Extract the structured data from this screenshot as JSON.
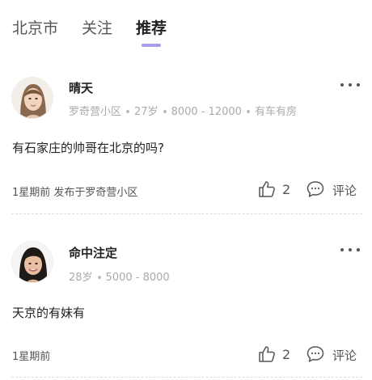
{
  "tabs": [
    {
      "label": "北京市"
    },
    {
      "label": "关注"
    },
    {
      "label": "推荐"
    }
  ],
  "colors": {
    "accent": "#a99bf0",
    "meta_text": "#aaaaaa",
    "primary_text": "#222222"
  },
  "posts": [
    {
      "name": "晴天",
      "meta": [
        "罗奇营小区",
        "27岁",
        "8000 - 12000",
        "有车有房"
      ],
      "content": "有石家庄的帅哥在北京的吗?",
      "time": "1星期前",
      "location": "发布于罗奇营小区",
      "likes": "2",
      "comment_label": "评论",
      "avatar_icon": "female-avatar",
      "more_icon": "more-dots-icon"
    },
    {
      "name": "命中注定",
      "meta": [
        "28岁",
        "5000 - 8000"
      ],
      "content": "天京的有妹有",
      "time": "1星期前",
      "location": "",
      "likes": "2",
      "comment_label": "评论",
      "avatar_icon": "female-avatar",
      "more_icon": "more-dots-icon"
    }
  ]
}
